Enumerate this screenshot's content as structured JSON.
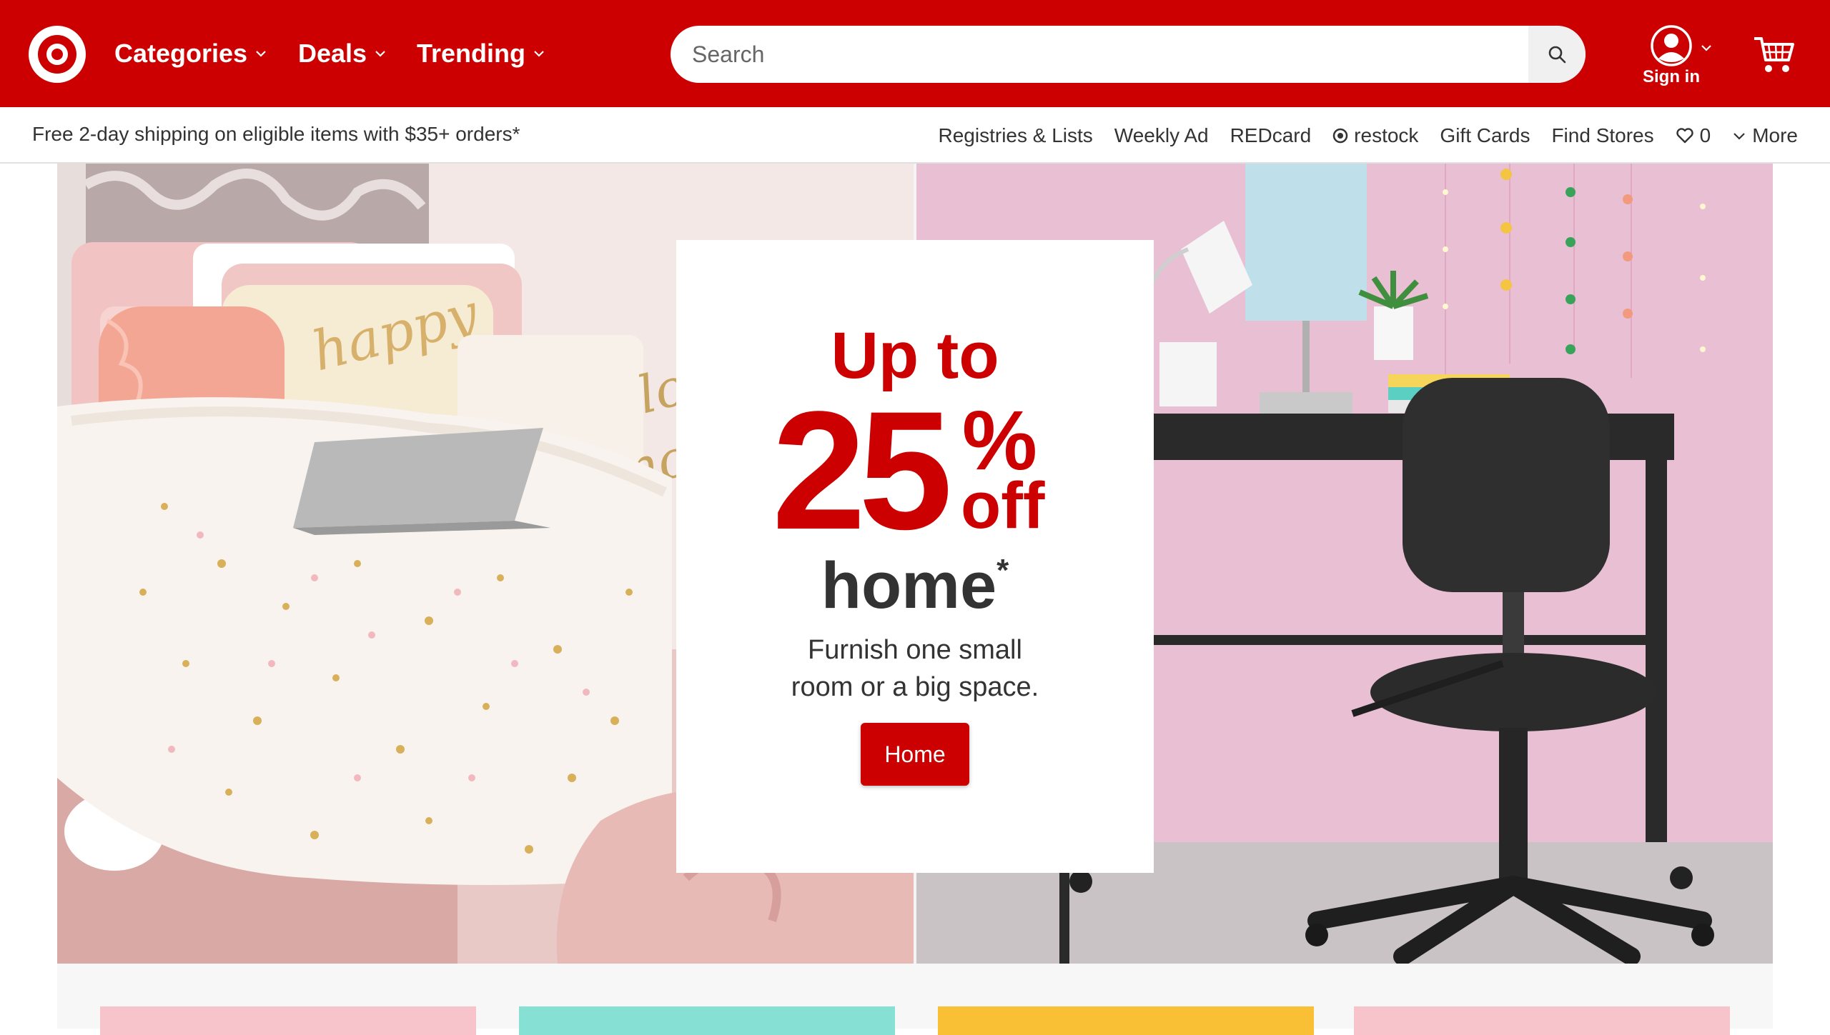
{
  "header": {
    "nav": [
      {
        "label": "Categories"
      },
      {
        "label": "Deals"
      },
      {
        "label": "Trending"
      }
    ],
    "search_placeholder": "Search",
    "sign_in_label": "Sign in",
    "colors": {
      "brand": "#cc0000"
    }
  },
  "utility": {
    "shipping": "Free 2-day shipping on eligible items with $35+ orders*",
    "links": [
      "Registries & Lists",
      "Weekly Ad",
      "REDcard",
      "restock",
      "Gift Cards",
      "Find Stores"
    ],
    "favorites_count": "0",
    "more_label": "More"
  },
  "promo": {
    "line1": "Up to",
    "percent": "25",
    "percent_sign": "%",
    "off": "off",
    "category": "home",
    "asterisk": "*",
    "description_line1": "Furnish one small",
    "description_line2": "room or a big space.",
    "button_label": "Home"
  },
  "tiles": [
    {
      "color": "#f7c4cc"
    },
    {
      "color": "#86e0d3"
    },
    {
      "color": "#f9c036"
    },
    {
      "color": "#f7c4cc"
    }
  ]
}
